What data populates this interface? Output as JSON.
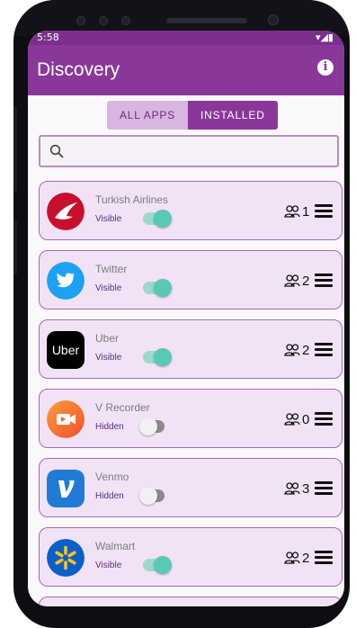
{
  "status_bar": {
    "time": "5:58",
    "icons_text": "▾◢▮"
  },
  "header": {
    "title": "Discovery",
    "info_icon": "info-icon"
  },
  "tabs": [
    {
      "label": "ALL APPS",
      "active": false
    },
    {
      "label": "INSTALLED",
      "active": true
    }
  ],
  "search": {
    "placeholder": "",
    "value": ""
  },
  "apps": [
    {
      "name": "Turkish Airlines",
      "visibility": "Visible",
      "enabled": true,
      "users": "1",
      "logo": "turkish-airlines-logo"
    },
    {
      "name": "Twitter",
      "visibility": "Visible",
      "enabled": true,
      "users": "2",
      "logo": "twitter-logo"
    },
    {
      "name": "Uber",
      "visibility": "Visible",
      "enabled": true,
      "users": "2",
      "logo": "uber-logo",
      "logo_text": "Uber"
    },
    {
      "name": "V Recorder",
      "visibility": "Hidden",
      "enabled": false,
      "users": "0",
      "logo": "v-recorder-logo"
    },
    {
      "name": "Venmo",
      "visibility": "Hidden",
      "enabled": false,
      "users": "3",
      "logo": "venmo-logo"
    },
    {
      "name": "Walmart",
      "visibility": "Visible",
      "enabled": true,
      "users": "2",
      "logo": "walmart-logo"
    }
  ],
  "colors": {
    "primary": "#8a379a",
    "tab_inactive": "#d9b5e2",
    "card": "#f1e3f5",
    "card_border": "#a56bb2",
    "toggle_on": "#58c9b4"
  }
}
